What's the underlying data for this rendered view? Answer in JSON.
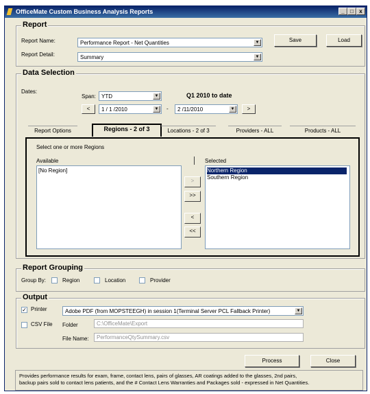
{
  "window": {
    "title": "OfficeMate Custom Business Analysis Reports",
    "min": "_",
    "max": "□",
    "close": "x"
  },
  "report": {
    "title": "Report",
    "name_label": "Report Name:",
    "name_value": "Performance Report - Net Quantities",
    "detail_label": "Report Detail:",
    "detail_value": "Summary",
    "save_label": "Save",
    "load_label": "Load"
  },
  "data_selection": {
    "title": "Data Selection",
    "dates_label": "Dates:",
    "span_label": "Span:",
    "span_value": "YTD",
    "period_text": "Q1 2010 to date",
    "prev": "<",
    "start_date": "1 / 1 /2010",
    "dash": "-",
    "end_date": "2 /11/2010",
    "next": ">"
  },
  "tabs": [
    {
      "label": "Report Options"
    },
    {
      "label": "Regions - 2 of 3"
    },
    {
      "label": "Locations - 2 of 3"
    },
    {
      "label": "Providers - ALL"
    },
    {
      "label": "Products - ALL"
    }
  ],
  "regions": {
    "instruction": "Select one or more Regions",
    "available_label": "Available",
    "selected_label": "Selected",
    "available": [
      "[No Region]"
    ],
    "selected": [
      "Northern Region",
      "Southern Region"
    ],
    "add_one": ">",
    "add_all": ">>",
    "remove_one": "<",
    "remove_all": "<<"
  },
  "grouping": {
    "title": "Report Grouping",
    "group_by_label": "Group By:",
    "region": "Region",
    "location": "Location",
    "provider": "Provider"
  },
  "output": {
    "title": "Output",
    "printer_label": "Printer",
    "printer_checked": "✓",
    "printer_value": "Adobe PDF (from MOPSTEEGH) in session 1(Terminal Server PCL Fallback Printer)",
    "csv_label": "CSV File",
    "folder_label": "Folder",
    "folder_value": "C:\\OfficeMate\\Export",
    "filename_label": "File Name:",
    "filename_value": "PerformanceQtySummary.csv"
  },
  "actions": {
    "process_label": "Process",
    "close_label": "Close"
  },
  "description": {
    "line1": "Provides performance results for exam, frame, contact lens, pairs of glasses, AR coatings added to the glasses, 2nd pairs,",
    "line2": "backup pairs sold to contact lens patients, and the # Contact Lens Warranties and Packages sold - expressed in Net Quantities."
  }
}
